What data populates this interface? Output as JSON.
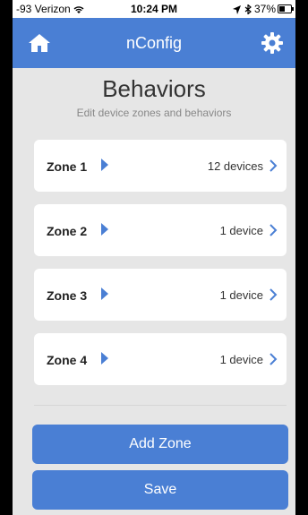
{
  "status_bar": {
    "carrier": "-93 Verizon",
    "time": "10:24 PM",
    "battery": "37%"
  },
  "nav": {
    "title": "nConfig",
    "home_icon": "home-icon",
    "settings_icon": "gear-icon"
  },
  "header": {
    "title": "Behaviors",
    "subtitle": "Edit device zones and behaviors"
  },
  "zones": [
    {
      "name": "Zone 1",
      "devices": "12 devices"
    },
    {
      "name": "Zone 2",
      "devices": "1 device"
    },
    {
      "name": "Zone 3",
      "devices": "1 device"
    },
    {
      "name": "Zone 4",
      "devices": "1 device"
    }
  ],
  "actions": {
    "add_zone": "Add Zone",
    "save": "Save"
  },
  "colors": {
    "accent": "#4a7fd4",
    "background": "#e6e6e6"
  }
}
